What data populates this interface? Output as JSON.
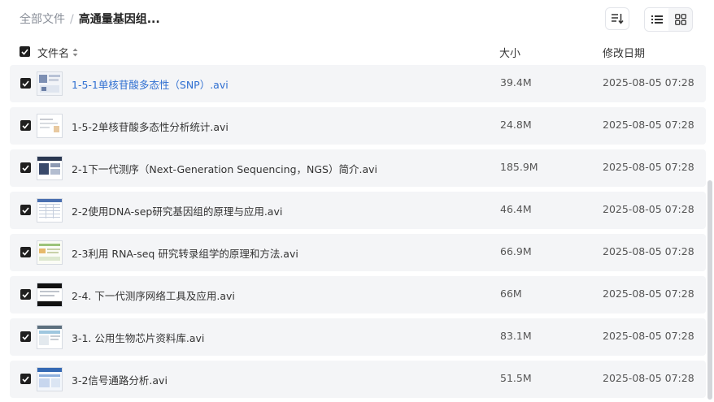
{
  "breadcrumb": {
    "root": "全部文件",
    "separator": "/",
    "current": "高通量基因组..."
  },
  "toolbar": {
    "sort_icon": "sort-list-icon",
    "view_list_icon": "list-view-icon",
    "view_grid_icon": "grid-view-icon"
  },
  "columns": {
    "name": "文件名",
    "size": "大小",
    "modified": "修改日期"
  },
  "files": [
    {
      "name": "1-5-1单核苷酸多态性（SNP）.avi",
      "size": "39.4M",
      "date": "2025-08-05 07:28",
      "checked": true,
      "highlighted": true,
      "thumb": "slide-diagram"
    },
    {
      "name": "1-5-2单核苷酸多态性分析统计.avi",
      "size": "24.8M",
      "date": "2025-08-05 07:28",
      "checked": true,
      "highlighted": false,
      "thumb": "slide-white"
    },
    {
      "name": "2-1下一代测序（Next-Generation Sequencing，NGS）简介.avi",
      "size": "185.9M",
      "date": "2025-08-05 07:28",
      "checked": true,
      "highlighted": false,
      "thumb": "slide-dark"
    },
    {
      "name": "2-2使用DNA-sep研究基因组的原理与应用.avi",
      "size": "46.4M",
      "date": "2025-08-05 07:28",
      "checked": true,
      "highlighted": false,
      "thumb": "slide-table"
    },
    {
      "name": "2-3利用 RNA-seq 研究转录组学的原理和方法.avi",
      "size": "66.9M",
      "date": "2025-08-05 07:28",
      "checked": true,
      "highlighted": false,
      "thumb": "slide-green"
    },
    {
      "name": "2-4. 下一代测序网络工具及应用.avi",
      "size": "66M",
      "date": "2025-08-05 07:28",
      "checked": true,
      "highlighted": false,
      "thumb": "slide-black"
    },
    {
      "name": "3-1. 公用生物芯片资料库.avi",
      "size": "83.1M",
      "date": "2025-08-05 07:28",
      "checked": true,
      "highlighted": false,
      "thumb": "slide-web"
    },
    {
      "name": "3-2信号通路分析.avi",
      "size": "51.5M",
      "date": "2025-08-05 07:28",
      "checked": true,
      "highlighted": false,
      "thumb": "slide-blue"
    }
  ],
  "colors": {
    "link": "#2f6fd1",
    "row_bg": "#f4f5f7",
    "checkbox": "#1f1f1f"
  }
}
